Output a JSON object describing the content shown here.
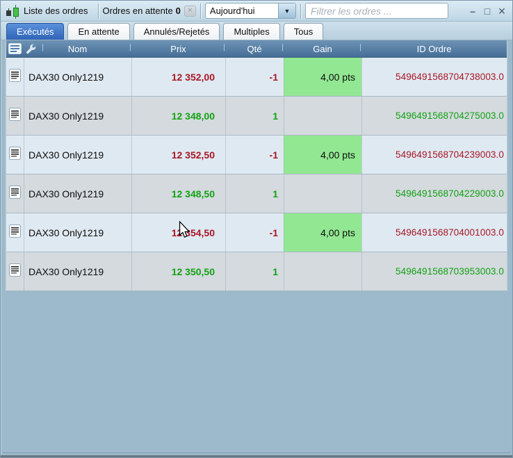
{
  "window": {
    "title": "Liste des ordres",
    "pending_label": "Ordres en attente",
    "pending_count": "0",
    "period_selected": "Aujourd'hui",
    "filter_placeholder": "Filtrer les ordres ...",
    "controls": {
      "minimize": "–",
      "maximize": "□",
      "close": "✕"
    }
  },
  "icons": {
    "app": "candlestick-chart",
    "clear": "✕",
    "dropdown_arrow": "▼",
    "header_report": "document-list",
    "header_tool": "wrench",
    "row_doc": "order-document"
  },
  "tabs": [
    {
      "label": "Exécutés",
      "active": true
    },
    {
      "label": "En attente",
      "active": false
    },
    {
      "label": "Annulés/Rejetés",
      "active": false
    },
    {
      "label": "Multiples",
      "active": false
    },
    {
      "label": "Tous",
      "active": false
    }
  ],
  "table": {
    "columns": [
      "Nom",
      "Prix",
      "Qté",
      "Gain",
      "ID Ordre"
    ],
    "rows": [
      {
        "name": "DAX30 Only1219",
        "price": "12 352,00",
        "qty": "-1",
        "gain": "4,00 pts",
        "id": "5496491568704738003.0",
        "side": "sell"
      },
      {
        "name": "DAX30 Only1219",
        "price": "12 348,00",
        "qty": "1",
        "gain": "",
        "id": "5496491568704275003.0",
        "side": "buy"
      },
      {
        "name": "DAX30 Only1219",
        "price": "12 352,50",
        "qty": "-1",
        "gain": "4,00 pts",
        "id": "5496491568704239003.0",
        "side": "sell"
      },
      {
        "name": "DAX30 Only1219",
        "price": "12 348,50",
        "qty": "1",
        "gain": "",
        "id": "5496491568704229003.0",
        "side": "buy"
      },
      {
        "name": "DAX30 Only1219",
        "price": "12 354,50",
        "qty": "-1",
        "gain": "4,00 pts",
        "id": "5496491568704001003.0",
        "side": "sell"
      },
      {
        "name": "DAX30 Only1219",
        "price": "12 350,50",
        "qty": "1",
        "gain": "",
        "id": "5496491568703953003.0",
        "side": "buy"
      }
    ]
  },
  "colors": {
    "sell_red": "#a81625",
    "buy_green": "#12a112",
    "gain_bg": "#92e892",
    "active_tab_blue": "#2f64b8",
    "header_blue": "#4d739a",
    "background_blue": "#9cbacb"
  }
}
